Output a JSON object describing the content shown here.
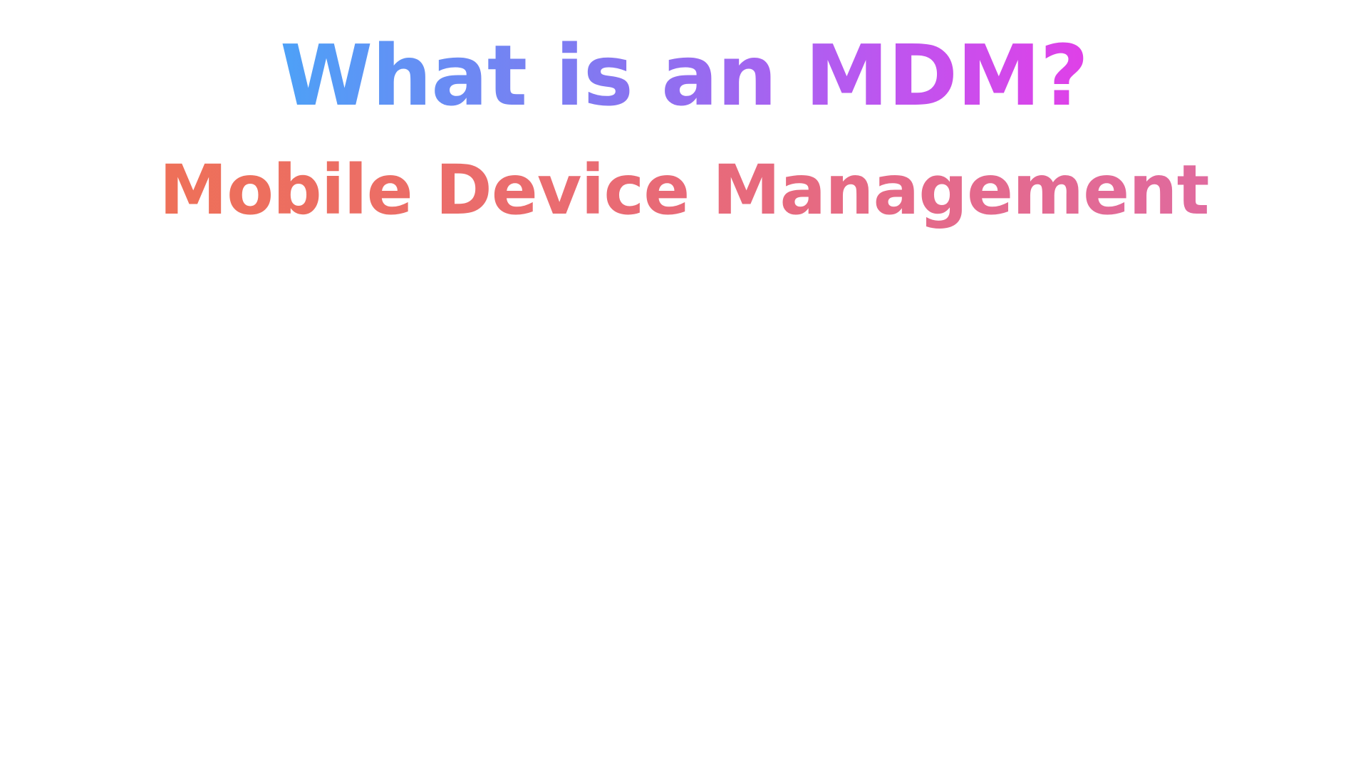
{
  "slide": {
    "title": "What is an MDM?",
    "subtitle": "Mobile Device Management"
  },
  "colors": {
    "title_gradient": [
      "#4da1f7",
      "#8b72f0",
      "#b65af0",
      "#e040e8"
    ],
    "subtitle_gradient": [
      "#ee7058",
      "#e86a78",
      "#e06a9e"
    ],
    "background": "#ffffff"
  }
}
